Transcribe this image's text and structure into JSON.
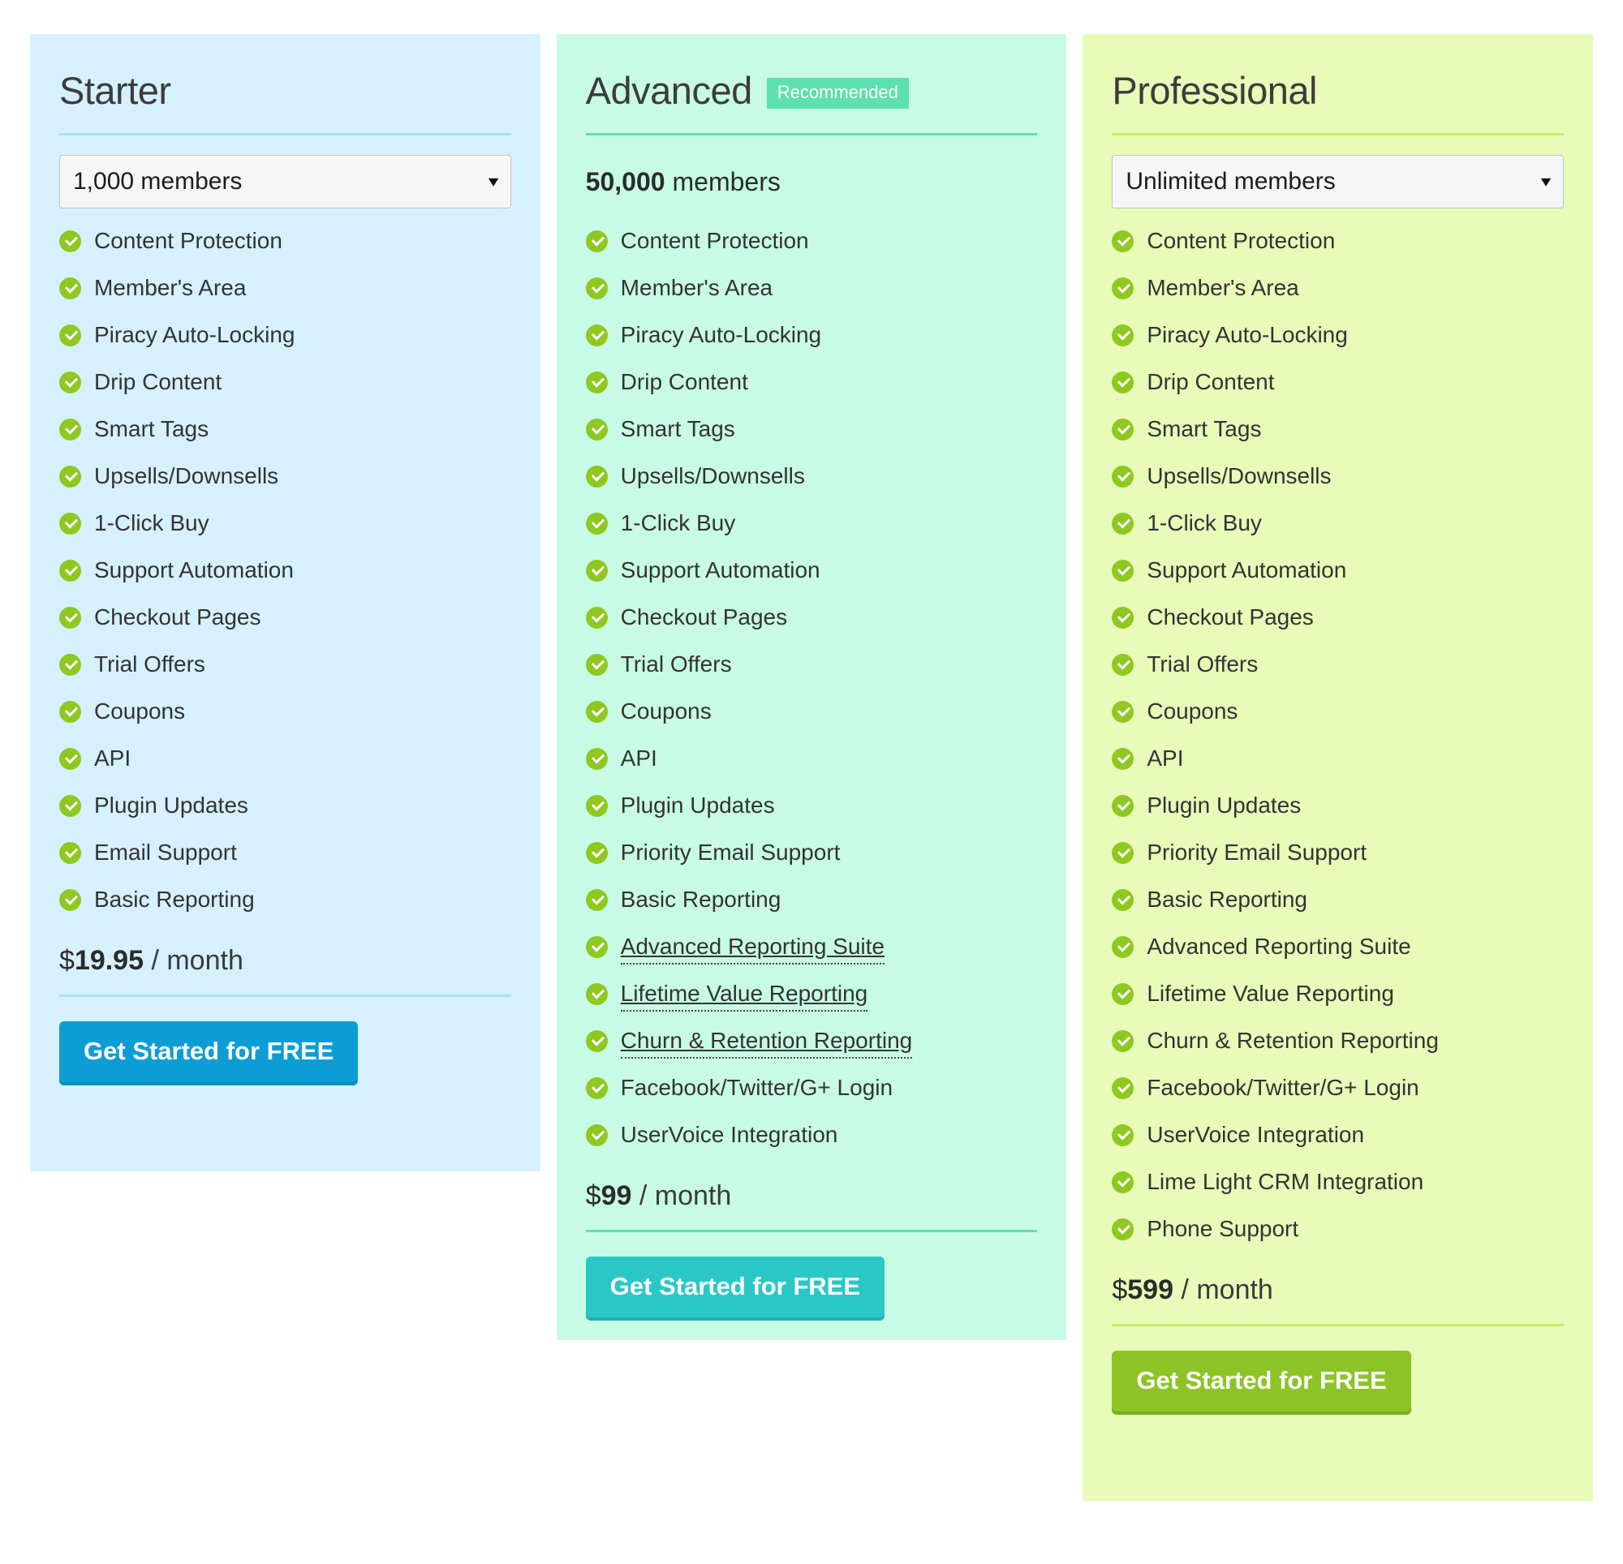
{
  "columns": [
    {
      "name": "Starter",
      "accent": "#a7e2f7",
      "background": "#d6f1fd",
      "badge": null,
      "members_control": "select",
      "members_value": "1,000 members",
      "members_caret": "▾",
      "features": [
        "Content Protection",
        "Member's Area",
        "Piracy Auto-Locking",
        "Drip Content",
        "Smart Tags",
        "Upsells/Downsells",
        "1-Click Buy",
        "Support Automation",
        "Checkout Pages",
        "Trial Offers",
        "Coupons",
        "API",
        "Plugin Updates",
        "Email Support",
        "Basic Reporting"
      ],
      "tooltip_features": [],
      "price_currency": "$",
      "price_amount": "19.95",
      "price_period": " / month",
      "cta_label": "Get Started for FREE",
      "cta_color": "#0d9dd4"
    },
    {
      "name": "Advanced",
      "accent": "#5de0b0",
      "background": "#c8fbe6",
      "badge": "Recommended",
      "members_control": "text",
      "members_value_bold": "50,000",
      "members_value_rest": "members",
      "features": [
        "Content Protection",
        "Member's Area",
        "Piracy Auto-Locking",
        "Drip Content",
        "Smart Tags",
        "Upsells/Downsells",
        "1-Click Buy",
        "Support Automation",
        "Checkout Pages",
        "Trial Offers",
        "Coupons",
        "API",
        "Plugin Updates",
        "Priority Email Support",
        "Basic Reporting",
        "Advanced Reporting Suite",
        "Lifetime Value Reporting",
        "Churn & Retention Reporting",
        "Facebook/Twitter/G+ Login",
        "UserVoice Integration"
      ],
      "tooltip_features": [
        "Advanced Reporting Suite",
        "Lifetime Value Reporting",
        "Churn & Retention Reporting"
      ],
      "price_currency": "$",
      "price_amount": "99",
      "price_period": " / month",
      "cta_label": "Get Started for FREE",
      "cta_color": "#2bc7c7"
    },
    {
      "name": "Professional",
      "accent": "#cdea62",
      "background": "#e8fbb8",
      "badge": null,
      "members_control": "select",
      "members_value": "Unlimited members",
      "members_caret": "▾",
      "features": [
        "Content Protection",
        "Member's Area",
        "Piracy Auto-Locking",
        "Drip Content",
        "Smart Tags",
        "Upsells/Downsells",
        "1-Click Buy",
        "Support Automation",
        "Checkout Pages",
        "Trial Offers",
        "Coupons",
        "API",
        "Plugin Updates",
        "Priority Email Support",
        "Basic Reporting",
        "Advanced Reporting Suite",
        "Lifetime Value Reporting",
        "Churn & Retention Reporting",
        "Facebook/Twitter/G+ Login",
        "UserVoice Integration",
        "Lime Light CRM Integration",
        "Phone Support"
      ],
      "tooltip_features": [],
      "price_currency": "$",
      "price_amount": "599",
      "price_period": " / month",
      "cta_label": "Get Started for FREE",
      "cta_color": "#8cc425"
    }
  ]
}
